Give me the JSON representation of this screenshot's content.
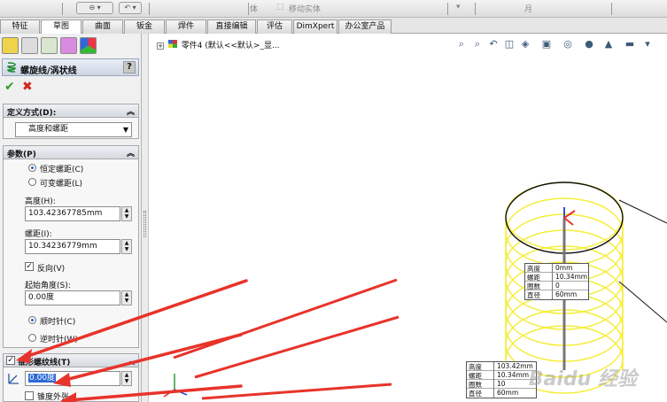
{
  "toolbar": {
    "move_solid": "移动实体",
    "partial_text_1": "体",
    "partial_text_2": "月"
  },
  "tabs": [
    {
      "label": "特征"
    },
    {
      "label": "草图"
    },
    {
      "label": "曲面"
    },
    {
      "label": "钣金"
    },
    {
      "label": "焊件"
    },
    {
      "label": "直接编辑"
    },
    {
      "label": "评估"
    },
    {
      "label": "DimXpert"
    },
    {
      "label": "办公室产品"
    }
  ],
  "panel": {
    "title": "螺旋线/涡状线",
    "help": "?",
    "ok_icon": "✔",
    "cancel_icon": "✖",
    "def_section": {
      "title": "定义方式(D):",
      "selected": "高度和螺距"
    },
    "param_section": {
      "title": "参数(P)",
      "radio_constant": "恒定螺距(C)",
      "radio_variable": "可变螺距(L)",
      "height_label": "高度(H):",
      "height_value": "103.42367785mm",
      "pitch_label": "螺距(I):",
      "pitch_value": "10.34236779mm",
      "reverse_label": "反向(V)",
      "start_angle_label": "起始角度(S):",
      "start_angle_value": "0.00度",
      "clockwise_label": "顺时针(C)",
      "counterclockwise_label": "逆时针(W)"
    },
    "taper_section": {
      "title": "锥形螺纹线(T)",
      "angle_value": "0.00度",
      "taper_outward_label": "锥度外张"
    }
  },
  "viewport": {
    "tree_label": "零件4 (默认<<默认>_显...",
    "callout_top": [
      {
        "k": "高度",
        "v": "0mm"
      },
      {
        "k": "螺距",
        "v": "10.34mm"
      },
      {
        "k": "圈数",
        "v": "0"
      },
      {
        "k": "直径",
        "v": "60mm"
      }
    ],
    "callout_bottom": [
      {
        "k": "高度",
        "v": "103.42mm"
      },
      {
        "k": "螺距",
        "v": "10.34mm"
      },
      {
        "k": "圈数",
        "v": "10"
      },
      {
        "k": "直径",
        "v": "60mm"
      }
    ],
    "watermark": "Baidu 经验"
  },
  "colors": {
    "helix": "#f5ee3a",
    "arrow": "#e8332a",
    "active_tab": "#ffffff"
  }
}
